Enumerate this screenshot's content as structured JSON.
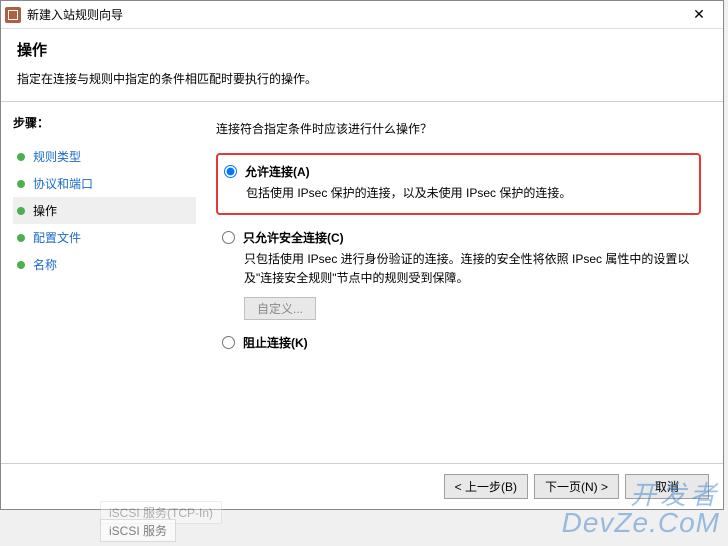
{
  "window": {
    "title": "新建入站规则向导"
  },
  "header": {
    "title": "操作",
    "subtitle": "指定在连接与规则中指定的条件相匹配时要执行的操作。"
  },
  "sidebar": {
    "title": "步骤：",
    "items": [
      {
        "label": "规则类型",
        "active": false
      },
      {
        "label": "协议和端口",
        "active": false
      },
      {
        "label": "操作",
        "active": true
      },
      {
        "label": "配置文件",
        "active": false
      },
      {
        "label": "名称",
        "active": false
      }
    ]
  },
  "main": {
    "prompt": "连接符合指定条件时应该进行什么操作？",
    "options": [
      {
        "id": "allow",
        "title": "允许连接(A)",
        "desc": "包括使用 IPsec 保护的连接，以及未使用 IPsec 保护的连接。",
        "checked": true,
        "highlighted": true
      },
      {
        "id": "secure",
        "title": "只允许安全连接(C)",
        "desc": "只包括使用 IPsec 进行身份验证的连接。连接的安全性将依照 IPsec 属性中的设置以及\"连接安全规则\"节点中的规则受到保障。",
        "checked": false,
        "customize_label": "自定义..."
      },
      {
        "id": "block",
        "title": "阻止连接(K)",
        "desc": "",
        "checked": false
      }
    ]
  },
  "footer": {
    "back": "< 上一步(B)",
    "next": "下一页(N) >",
    "cancel": "取消"
  },
  "background": {
    "row": "iSCSI 服务(TCP-In)",
    "row2": "iSCSI 服务"
  },
  "watermark": {
    "zh": "开发者",
    "en": "DevZe.CoM"
  }
}
